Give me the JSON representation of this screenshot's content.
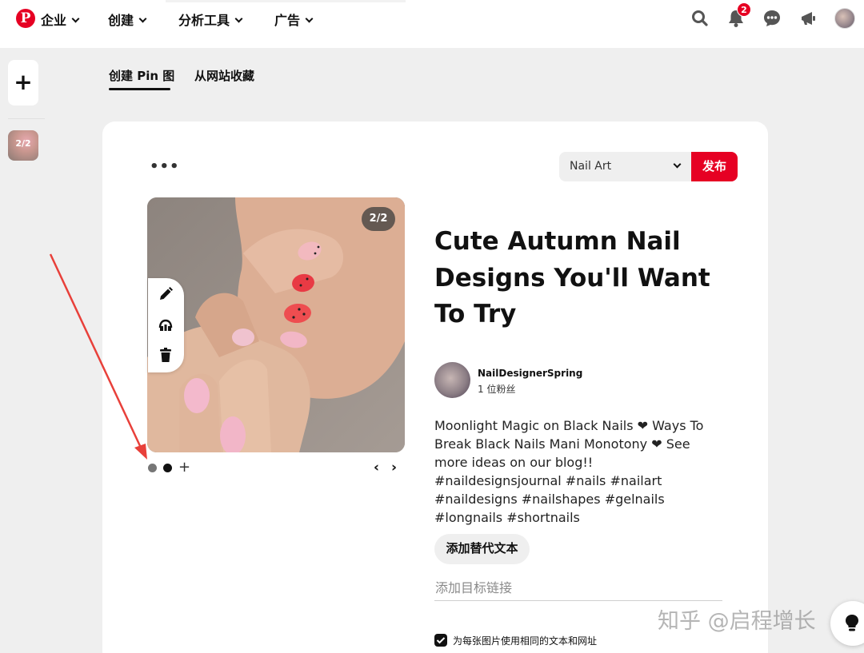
{
  "nav": {
    "logo_letter": "P",
    "items": [
      {
        "label": "企业"
      },
      {
        "label": "创建"
      },
      {
        "label": "分析工具"
      },
      {
        "label": "广告"
      }
    ],
    "notification_count": "2"
  },
  "rail": {
    "add_label": "+",
    "thumb_label": "2/2"
  },
  "tabs": [
    {
      "label": "创建 Pin 图"
    },
    {
      "label": "从网站收藏"
    }
  ],
  "editor": {
    "more_label": "•••",
    "board_select": "Nail Art",
    "publish_label": "发布",
    "image_counter": "2/2",
    "add_image_label": "+",
    "prev_label": "‹",
    "next_label": "›"
  },
  "pin": {
    "title": "Cute Autumn Nail Designs You'll Want To Try",
    "author_name": "NailDesignerSpring",
    "author_followers": "1 位粉丝",
    "description": "Moonlight Magic on Black Nails ❤ Ways To Break Black Nails Mani Monotony ❤ See more ideas on our blog!! #naildesignsjournal #nails #nailart #naildesigns #nailshapes #gelnails #longnails #shortnails",
    "alt_text_button": "添加替代文本",
    "link_placeholder": "添加目标链接",
    "same_text_checkbox_label": "为每张图片使用相同的文本和网址",
    "same_text_checked": true
  },
  "watermark": "知乎 @启程增长",
  "colors": {
    "brand_red": "#e60023",
    "annotation_arrow": "#e8403a"
  },
  "icons": [
    "pinterest-logo-icon",
    "search-icon",
    "bell-icon",
    "chat-icon",
    "megaphone-icon",
    "pencil-icon",
    "crop-icon",
    "trash-icon",
    "checkbox-check-icon",
    "lightbulb-icon"
  ]
}
